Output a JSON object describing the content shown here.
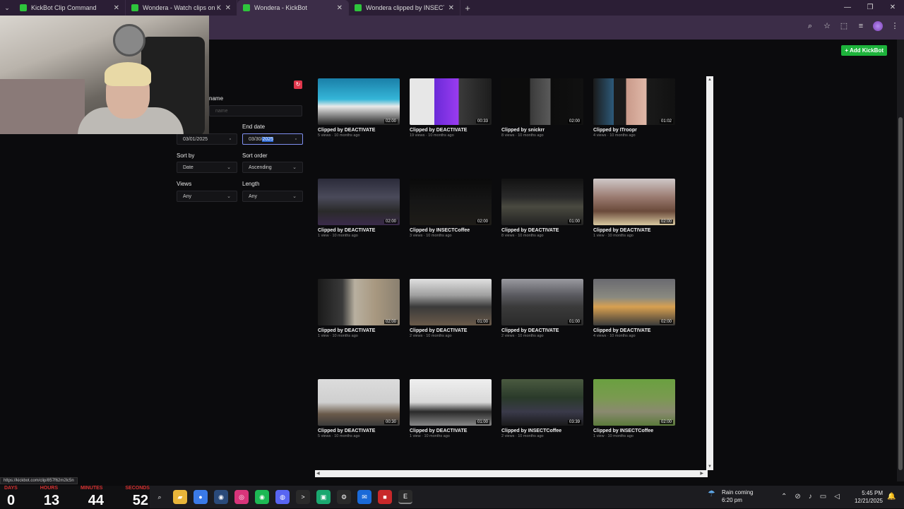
{
  "browser": {
    "tabs": [
      {
        "title": "KickBot Clip Command",
        "color": "#2ec53c",
        "active": false
      },
      {
        "title": "Wondera - Watch clips on Kick",
        "color": "#2ec53c",
        "active": false
      },
      {
        "title": "Wondera - KickBot",
        "color": "#2ec53c",
        "active": true
      },
      {
        "title": "Wondera clipped by INSECTCoffee",
        "color": "#2ec53c",
        "active": false
      }
    ],
    "new_tab": "+",
    "window_controls": [
      "—",
      "❐",
      "✕"
    ],
    "toolbar_icons": [
      "zoom-icon",
      "star-icon",
      "extensions-icon",
      "media-icon",
      "profile-icon",
      "menu-icon"
    ]
  },
  "page": {
    "add_button": "+ Add KickBot",
    "filters": {
      "name_label": "name",
      "name_placeholder": "name",
      "end_date_label": "End date",
      "start_date_value": "03/01/2025",
      "end_date_prefix": "03/30/",
      "end_date_selected": "2025",
      "sort_by_label": "Sort by",
      "sort_by_value": "Date",
      "sort_order_label": "Sort order",
      "sort_order_value": "Ascending",
      "views_label": "Views",
      "views_value": "Any",
      "length_label": "Length",
      "length_value": "Any"
    },
    "clips": [
      {
        "title": "Clipped by DEACTIVATE",
        "meta": "5 views · 10 months ago",
        "duration": "02:00",
        "bg": "linear-gradient(180deg,#1a7fa8 0%,#35b6d8 45%,#e9e9e9 60%,#222 100%)"
      },
      {
        "title": "Clipped by DEACTIVATE",
        "meta": "19 views · 10 months ago",
        "duration": "00:33",
        "bg": "linear-gradient(90deg,#e7e7e7 0%,#e7e7e7 30%,#6a2ad8 30%,#9a3cf0 60%,#3a3a3a 60%,#1d1d1d 100%)"
      },
      {
        "title": "Clipped by snickrr",
        "meta": "8 views · 10 months ago",
        "duration": "02:00",
        "bg": "linear-gradient(90deg,#0c0c0c 0%,#0c0c0c 35%,#3a3a3a 35%,#5a5a5a 60%,#0c0c0c 60%,#111 100%)"
      },
      {
        "title": "Clipped by ITroopr",
        "meta": "4 views · 10 months ago",
        "duration": "01:02",
        "bg": "linear-gradient(90deg,#1a1a1a 0%,#2d5a7a 25%,#1a1a1a 25%,#1a1a1a 40%,#c99a8a 40%,#e0b8a8 65%,#1a1a1a 65%,#111 100%)"
      },
      {
        "title": "Clipped by DEACTIVATE",
        "meta": "1 view · 10 months ago",
        "duration": "02:00",
        "bg": "linear-gradient(180deg,#2b2b3a 0%,#4a4a5a 40%,#2a2a2a 70%,#3a2a4a 100%)"
      },
      {
        "title": "Clipped by INSECTCoffee",
        "meta": "3 views · 10 months ago",
        "duration": "02:00",
        "bg": "linear-gradient(180deg,#0a0a0a 0%,#161616 50%,#1e1c18 100%)"
      },
      {
        "title": "Clipped by DEACTIVATE",
        "meta": "8 views · 10 months ago",
        "duration": "01:00",
        "bg": "linear-gradient(180deg,#121212 0%,#2a2a2a 40%,#4a4a40 60%,#222 100%)"
      },
      {
        "title": "Clipped by DEACTIVATE",
        "meta": "1 view · 10 months ago",
        "duration": "02:00",
        "bg": "linear-gradient(180deg,#cfc8c8 0%,#9a7a70 40%,#6a4a3a 70%,#d8c8a0 100%)"
      },
      {
        "title": "Clipped by DEACTIVATE",
        "meta": "1 view · 10 months ago",
        "duration": "02:00",
        "bg": "linear-gradient(90deg,#1a1a1a 0%,#3a3a3a 30%,#b8b0a0 45%,#a89880 70%,#8a8070 100%)"
      },
      {
        "title": "Clipped by DEACTIVATE",
        "meta": "2 views · 10 months ago",
        "duration": "01:00",
        "bg": "linear-gradient(180deg,#e0e0e0 0%,#a0a0a0 35%,#3a3a3a 60%,#6a5a4a 100%)"
      },
      {
        "title": "Clipped by DEACTIVATE",
        "meta": "2 views · 10 months ago",
        "duration": "01:00",
        "bg": "linear-gradient(180deg,#9a9aa0 0%,#5a5a60 35%,#3a3a3a 60%,#2a2a2a 100%)"
      },
      {
        "title": "Clipped by DEACTIVATE",
        "meta": "4 views · 10 months ago",
        "duration": "02:00",
        "bg": "linear-gradient(180deg,#6a6a70 0%,#8a8a80 40%,#d8a050 60%,#3a3a3a 100%)"
      },
      {
        "title": "Clipped by DEACTIVATE",
        "meta": "5 views · 10 months ago",
        "duration": "00:30",
        "bg": "linear-gradient(180deg,#dcdcdc 0%,#cfcfcf 50%,#6a5a4a 75%,#3a3a3a 100%)"
      },
      {
        "title": "Clipped by DEACTIVATE",
        "meta": "1 view · 10 months ago",
        "duration": "01:00",
        "bg": "linear-gradient(180deg,#efefef 0%,#d8d8d8 50%,#2a2a2a 70%,#888 100%)"
      },
      {
        "title": "Clipped by INSECTCoffee",
        "meta": "2 views · 10 months ago",
        "duration": "03:39",
        "bg": "linear-gradient(180deg,#4a5a40 0%,#2a3a2a 40%,#3a3a4a 70%,#1a1a1a 100%)"
      },
      {
        "title": "Clipped by INSECTCoffee",
        "meta": "1 view · 10 months ago",
        "duration": "02:00",
        "bg": "linear-gradient(180deg,#6aa040 0%,#7a9a50 40%,#8a8a70 70%,#5a7a3a 100%)"
      }
    ]
  },
  "status_url": "https://kickbot.com/clip/857f62m2lc5n",
  "counters": {
    "labels": [
      "DAYS",
      "HOURS",
      "MINUTES",
      "SECONDS"
    ],
    "values": [
      "0",
      "13",
      "44",
      "52"
    ]
  },
  "taskbar": {
    "apps": [
      {
        "name": "search-icon",
        "glyph": "⌕",
        "color": "#1c1c20"
      },
      {
        "name": "file-explorer-icon",
        "glyph": "▰",
        "color": "#e8b53a"
      },
      {
        "name": "chrome-icon",
        "glyph": "●",
        "color": "#3a7ae8"
      },
      {
        "name": "steam-icon",
        "glyph": "◉",
        "color": "#2a4a7a"
      },
      {
        "name": "instagram-icon",
        "glyph": "◎",
        "color": "#d8347a"
      },
      {
        "name": "spotify-icon",
        "glyph": "◉",
        "color": "#1db954"
      },
      {
        "name": "discord-icon",
        "glyph": "◍",
        "color": "#5865f2"
      },
      {
        "name": "terminal-icon",
        "glyph": ">",
        "color": "#2a2a2a"
      },
      {
        "name": "app-green-icon",
        "glyph": "▣",
        "color": "#1aa870"
      },
      {
        "name": "settings-icon",
        "glyph": "⚙",
        "color": "#2a2a2a"
      },
      {
        "name": "outlook-icon",
        "glyph": "✉",
        "color": "#1a6ad8"
      },
      {
        "name": "app-red-icon",
        "glyph": "■",
        "color": "#c8282a"
      },
      {
        "name": "epic-games-icon",
        "glyph": "E",
        "color": "#2a2a2a"
      }
    ],
    "weather_title": "Rain coming",
    "weather_time": "6:20 pm",
    "tray_icons": [
      "chevron-up-icon",
      "mute-icon",
      "mic-icon",
      "network-icon",
      "volume-icon"
    ],
    "clock_time": "5:45 PM",
    "clock_date": "12/21/2025"
  }
}
